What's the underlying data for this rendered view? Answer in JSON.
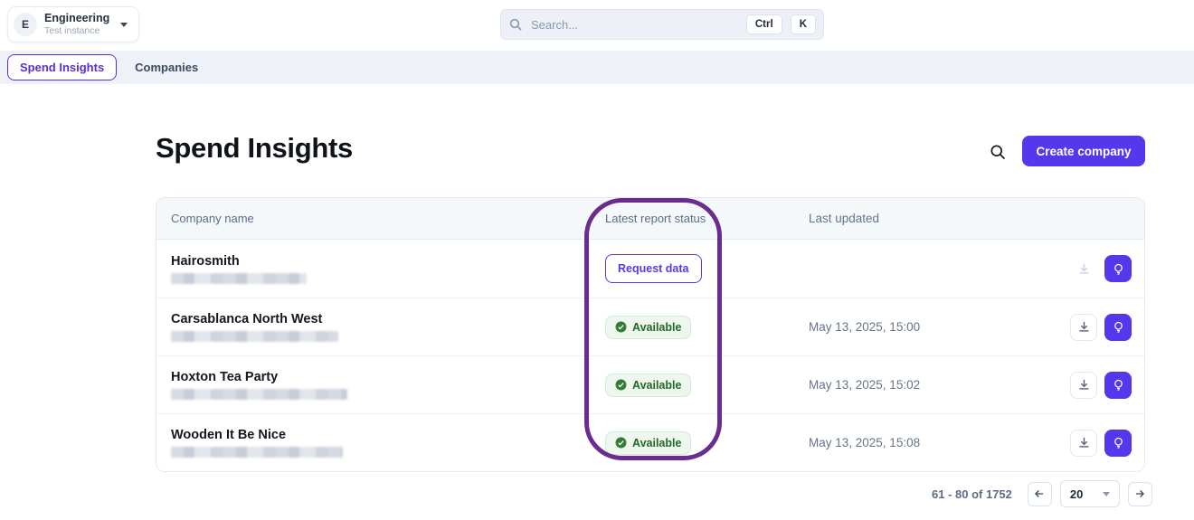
{
  "topbar": {
    "workspace": {
      "initial": "E",
      "name": "Engineering",
      "subtitle": "Test instance"
    },
    "search": {
      "placeholder": "Search...",
      "shortcut": [
        "Ctrl",
        "K"
      ]
    }
  },
  "tabs": {
    "spend_insights": "Spend Insights",
    "companies": "Companies"
  },
  "page": {
    "title": "Spend Insights",
    "create_button": "Create company"
  },
  "table": {
    "columns": {
      "company": "Company name",
      "status": "Latest report status",
      "updated": "Last updated"
    },
    "rows": [
      {
        "company": "Hairosmith",
        "status": "Request data",
        "status_type": "request",
        "last_updated": ""
      },
      {
        "company": "Carsablanca North West",
        "status": "Available",
        "status_type": "available",
        "last_updated": "May 13, 2025, 15:00"
      },
      {
        "company": "Hoxton Tea Party",
        "status": "Available",
        "status_type": "available",
        "last_updated": "May 13, 2025, 15:02"
      },
      {
        "company": "Wooden It Be Nice",
        "status": "Available",
        "status_type": "available",
        "last_updated": "May 13, 2025, 15:08"
      }
    ]
  },
  "pagination": {
    "range": "61 - 80 of 1752",
    "page_size": "20"
  },
  "annotation": {
    "purpose": "highlight around Latest report status column",
    "color": "#6a2d8f"
  },
  "colors": {
    "accent_purple": "#5537ec",
    "tab_purple": "#5b2ed3",
    "annotation_purple": "#6a2d8f",
    "available_green_text": "#21672a",
    "available_green_bg": "#eef7ee"
  }
}
